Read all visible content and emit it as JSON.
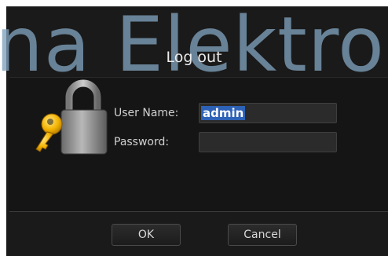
{
  "watermark": {
    "text": "na Elektro"
  },
  "dialog": {
    "title": "Log out",
    "username_label": "User Name:",
    "username_value": "admin",
    "password_label": "Password:",
    "password_value": ""
  },
  "buttons": {
    "ok_label": "OK",
    "cancel_label": "Cancel"
  },
  "icons": {
    "lock": "padlock-icon",
    "key": "key-icon"
  }
}
